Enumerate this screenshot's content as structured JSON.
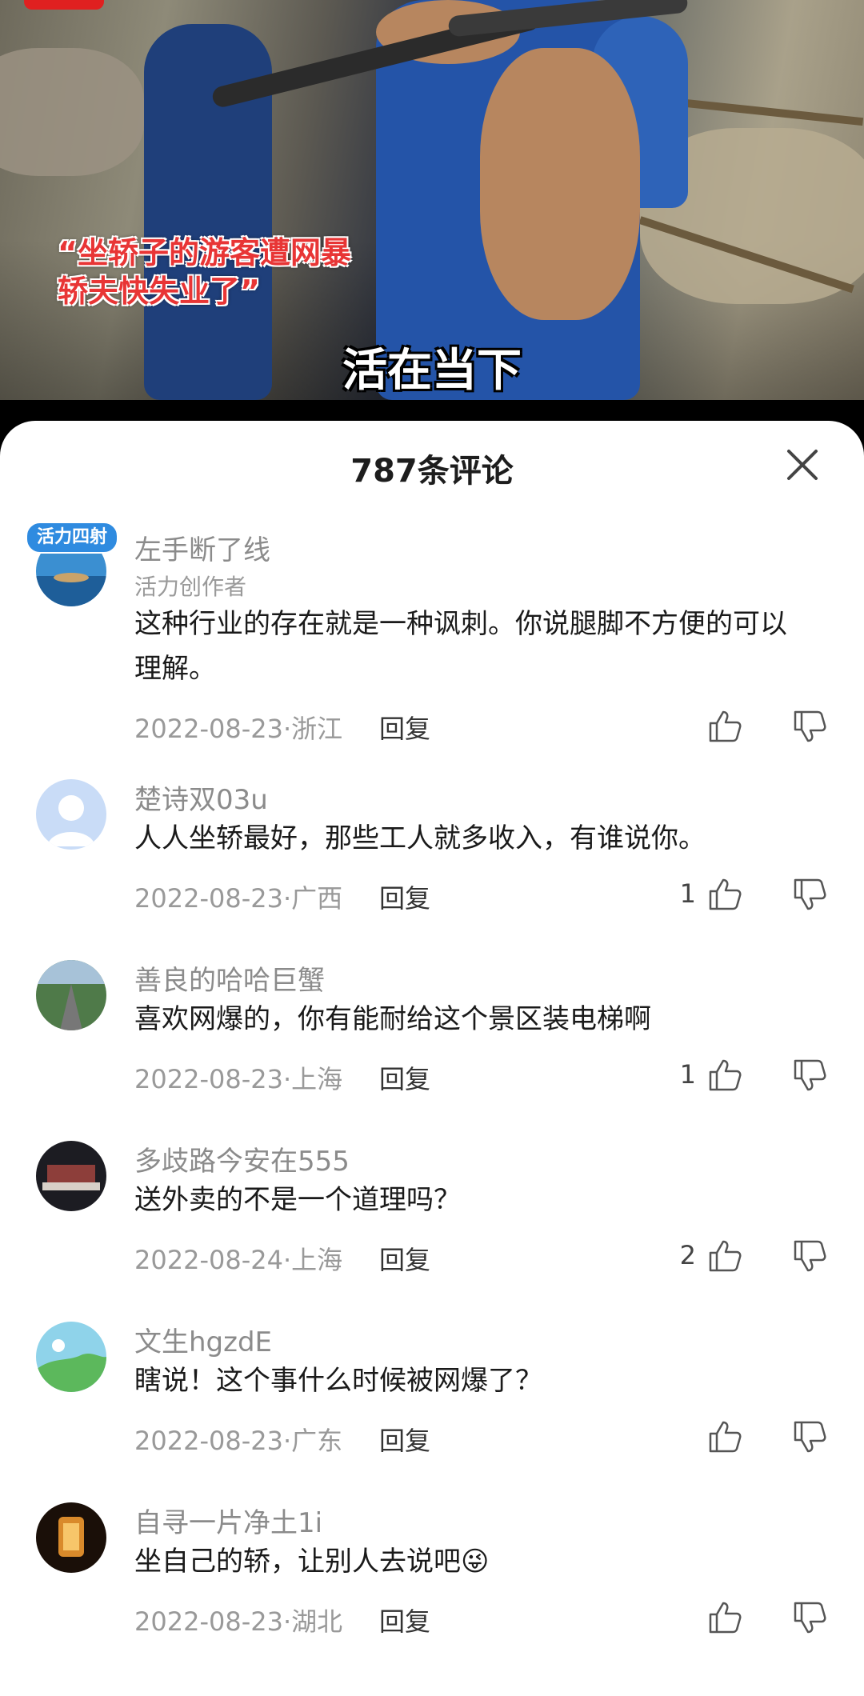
{
  "video": {
    "caption_line1": "“坐轿子的游客遭网暴",
    "caption_line2": "轿夫快失业了”",
    "big_caption": "活在当下"
  },
  "sheet": {
    "title": "787条评论",
    "close_icon": "close-icon"
  },
  "comments": [
    {
      "username": "左手断了线",
      "subtitle": "活力创作者",
      "avatar_badge": "活力四射",
      "text_line1": "这种行业的存在就是一种讽刺。你说腿脚不方便的可以",
      "text_line2": "理解。",
      "meta": "2022-08-23·浙江",
      "reply": "回复",
      "likes": ""
    },
    {
      "username": "楚诗双03u",
      "text_line1": "人人坐轿最好，那些工人就多收入，有谁说你。",
      "meta": "2022-08-23·广西",
      "reply": "回复",
      "likes": "1"
    },
    {
      "username": "善良的哈哈巨蟹",
      "text_line1": "喜欢网爆的，你有能耐给这个景区装电梯啊",
      "meta": "2022-08-23·上海",
      "reply": "回复",
      "likes": "1"
    },
    {
      "username": "多歧路今安在555",
      "text_line1": "送外卖的不是一个道理吗？",
      "meta": "2022-08-24·上海",
      "reply": "回复",
      "likes": "2"
    },
    {
      "username": "文生hgzdE",
      "text_line1": "瞎说！这个事什么时候被网爆了？",
      "meta": "2022-08-23·广东",
      "reply": "回复",
      "likes": ""
    },
    {
      "username": "自寻一片净土1i",
      "text_line1": "坐自己的轿，让别人去说吧",
      "emoji": "😜",
      "meta": "2022-08-23·湖北",
      "reply": "回复",
      "likes": ""
    }
  ],
  "icons": {
    "like": "thumbs-up-icon",
    "dislike": "thumbs-down-icon"
  }
}
